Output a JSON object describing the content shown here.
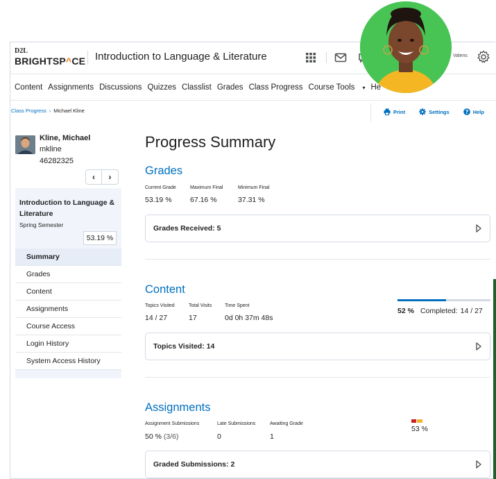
{
  "header": {
    "logo_top": "D2L",
    "logo_main_a": "BRIGHTSP",
    "logo_main_dot": "^",
    "logo_main_b": "CE",
    "course_title": "Introduction to Language & Literature",
    "user_name": "Valens"
  },
  "nav": {
    "items": [
      "Content",
      "Assignments",
      "Discussions",
      "Quizzes",
      "Classlist",
      "Grades",
      "Class Progress",
      "Course Tools",
      "Help"
    ],
    "course_tools_chevron": "⌄",
    "help_visible": "He"
  },
  "breadcrumb": {
    "link": "Class Progress",
    "sep": "›",
    "current": "Michael Kline"
  },
  "tools": {
    "print": "Print",
    "settings": "Settings",
    "help": "Help"
  },
  "student": {
    "name": "Kline, Michael",
    "username": "mkline",
    "id": "46282325",
    "prev": "‹",
    "next": "›"
  },
  "side": {
    "course": "Introduction to Language & Literature",
    "semester": "Spring Semester",
    "grade": "53.19 %",
    "menu": [
      "Summary",
      "Grades",
      "Content",
      "Assignments",
      "Course Access",
      "Login History",
      "System Access History"
    ]
  },
  "main": {
    "title": "Progress Summary",
    "grades": {
      "title": "Grades",
      "labels": [
        "Current Grade",
        "Maximum Final",
        "Minimum Final"
      ],
      "values": [
        "53.19 %",
        "67.16 %",
        "37.31 %"
      ],
      "card": "Grades Received: 5"
    },
    "content": {
      "title": "Content",
      "labels": [
        "Topics Visited",
        "Total Visits",
        "Time Spent"
      ],
      "values": [
        "14 / 27",
        "17",
        "0d 0h 37m 48s"
      ],
      "card": "Topics Visited: 14",
      "progress_percent": "52 %",
      "progress_fraction": 0.52,
      "completed_label": "Completed:",
      "completed_value": "14 / 27"
    },
    "assignments": {
      "title": "Assignments",
      "labels": [
        "Assignment Submissions",
        "Late Submissions",
        "Awaiting Grade"
      ],
      "values": [
        "50 %",
        "0",
        "1"
      ],
      "submissions_extra": "(3/6)",
      "card": "Graded Submissions: 2",
      "percent": "53 %"
    }
  },
  "colors": {
    "link": "#006fbf",
    "accent_orange": "#e87511",
    "avatar_green": "#48c454",
    "panel_bg": "#f1f5fb"
  }
}
